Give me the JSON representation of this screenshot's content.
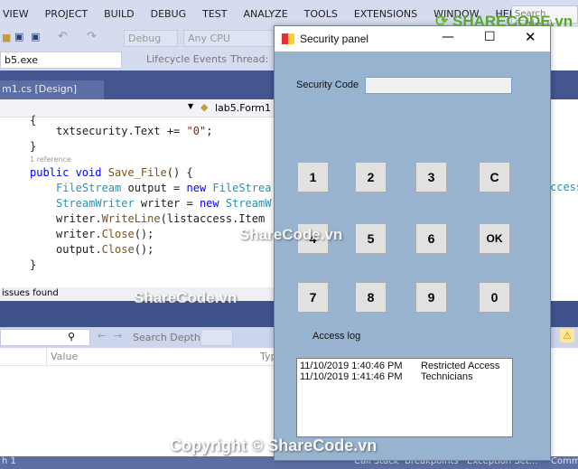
{
  "menu": [
    "VIEW",
    "PROJECT",
    "BUILD",
    "DEBUG",
    "TEST",
    "ANALYZE",
    "TOOLS",
    "EXTENSIONS",
    "WINDOW",
    "HELP"
  ],
  "search_placeholder": "Search (Ctrl+Q)",
  "toolbar": {
    "config": "Debug",
    "platform": "Any CPU",
    "process": "b5.exe",
    "lifecycle": "Lifecycle Events",
    "thread": "Thread:"
  },
  "doc_tab": "m1.cs [Design]",
  "nav_member": "lab5.Form1",
  "code": {
    "reference": "1 reference"
  },
  "status_issues": "issues found",
  "locals": {
    "search_depth": "Search Depth:",
    "col_value": "Value",
    "col_type": "Typ"
  },
  "bottom_tabs": [
    "Call Stack",
    "Breakpoints",
    "Exception Set...",
    "Comm"
  ],
  "bottom_left": "h 1",
  "dialog": {
    "title": "Security panel",
    "security_label": "Security Code",
    "security_value": "",
    "keys": [
      "1",
      "2",
      "3",
      "C",
      "4",
      "5",
      "6",
      "OK",
      "7",
      "8",
      "9",
      "0"
    ],
    "access_log_label": "Access log",
    "log": [
      {
        "time": "11/10/2019 1:40:46 PM",
        "group": "Restricted Access"
      },
      {
        "time": "11/10/2019 1:41:46 PM",
        "group": "Technicians"
      }
    ]
  },
  "watermarks": {
    "logo": "SHARECODE.vn",
    "mid": "ShareCode.vn",
    "copyright": "Copyright © ShareCode.vn"
  }
}
